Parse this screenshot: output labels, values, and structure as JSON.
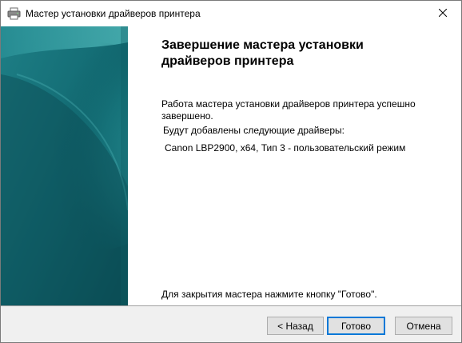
{
  "window": {
    "title": "Мастер установки драйверов принтера",
    "icon": "printer-icon",
    "close_symbol": "✕"
  },
  "content": {
    "heading_line1": "Завершение мастера установки",
    "heading_line2": "драйверов принтера",
    "success_text": "Работа мастера установки драйверов принтера успешно завершено.",
    "drivers_intro": "Будут добавлены следующие драйверы:",
    "driver_item": "Canon LBP2900, x64, Тип 3 - пользовательский режим",
    "closing_hint": "Для закрытия мастера нажмите кнопку \"Готово\"."
  },
  "buttons": {
    "back": "< Назад",
    "finish": "Готово",
    "cancel": "Отмена"
  },
  "colors": {
    "banner_dark": "#0b4e55",
    "banner_light": "#2f9aa0",
    "default_button_border": "#0078d7"
  }
}
